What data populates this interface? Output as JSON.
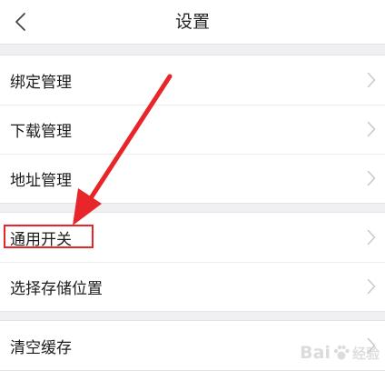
{
  "header": {
    "title": "设置"
  },
  "groups": [
    {
      "items": [
        {
          "label": "绑定管理"
        },
        {
          "label": "下载管理"
        },
        {
          "label": "地址管理"
        }
      ]
    },
    {
      "items": [
        {
          "label": "通用开关"
        },
        {
          "label": "选择存储位置"
        }
      ]
    },
    {
      "items": [
        {
          "label": "清空缓存"
        }
      ]
    }
  ],
  "watermark": {
    "brand": "Bai",
    "suffix": "经验"
  },
  "colors": {
    "annotation": "#e8262a",
    "background": "#f0f0f2",
    "chevron": "#c7c7cc"
  }
}
